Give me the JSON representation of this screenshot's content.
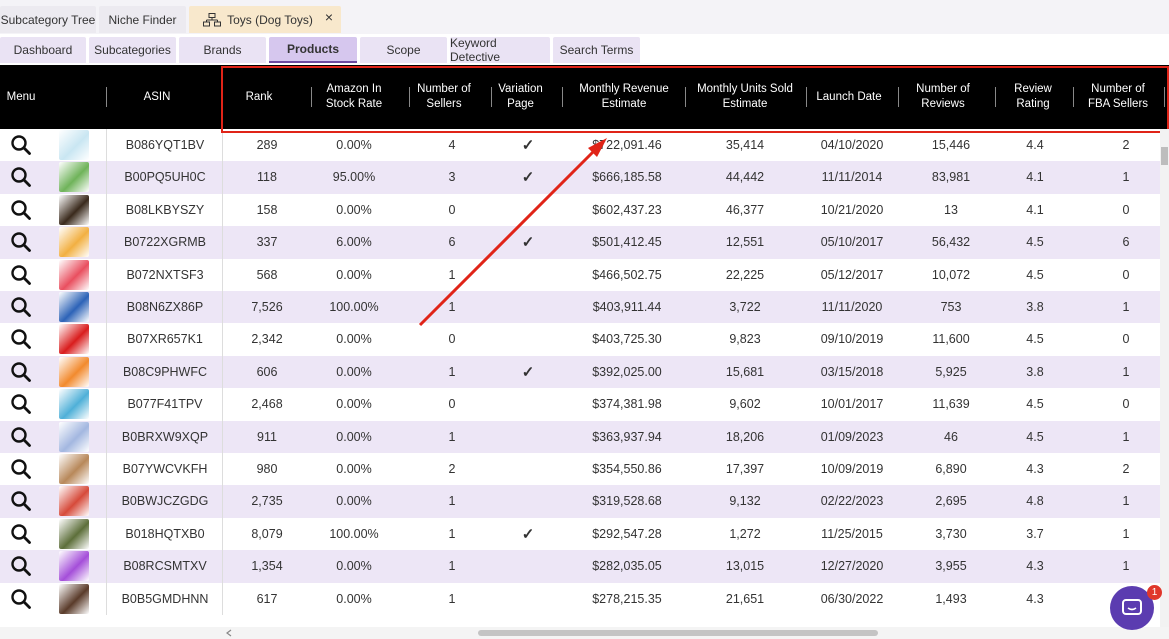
{
  "top_tabs": [
    {
      "label": "Subcategory Tree"
    },
    {
      "label": "Niche Finder"
    },
    {
      "label": "Toys (Dog Toys)"
    }
  ],
  "close_glyph": "×",
  "nav_tabs": [
    {
      "label": "Dashboard"
    },
    {
      "label": "Subcategories"
    },
    {
      "label": "Brands"
    },
    {
      "label": "Products"
    },
    {
      "label": "Scope"
    },
    {
      "label": "Keyword Detective"
    },
    {
      "label": "Search Terms"
    }
  ],
  "columns": [
    "Menu",
    "ASIN",
    "Rank",
    "Amazon In Stock Rate",
    "Number of Sellers",
    "Variation Page",
    "Monthly Revenue Estimate",
    "Monthly Units Sold Estimate",
    "Launch Date",
    "Number of Reviews",
    "Review Rating",
    "Number of FBA Sellers"
  ],
  "colors": {
    "accent": "#6b4aa0",
    "highlight": "#e02418",
    "row_alt": "#ede6f6",
    "header_bg": "#000000"
  },
  "check_glyph": "✓",
  "rows": [
    {
      "asin": "B086YQT1BV",
      "rank": "289",
      "stock": "0.00%",
      "sellers": "4",
      "variation": true,
      "revenue": "$722,091.46",
      "units": "35,414",
      "launch": "04/10/2020",
      "reviews": "15,446",
      "rating": "4.4",
      "fba": "2"
    },
    {
      "asin": "B00PQ5UH0C",
      "rank": "118",
      "stock": "95.00%",
      "sellers": "3",
      "variation": true,
      "revenue": "$666,185.58",
      "units": "44,442",
      "launch": "11/11/2014",
      "reviews": "83,981",
      "rating": "4.1",
      "fba": "1"
    },
    {
      "asin": "B08LKBYSZY",
      "rank": "158",
      "stock": "0.00%",
      "sellers": "0",
      "variation": false,
      "revenue": "$602,437.23",
      "units": "46,377",
      "launch": "10/21/2020",
      "reviews": "13",
      "rating": "4.1",
      "fba": "0"
    },
    {
      "asin": "B0722XGRMB",
      "rank": "337",
      "stock": "6.00%",
      "sellers": "6",
      "variation": true,
      "revenue": "$501,412.45",
      "units": "12,551",
      "launch": "05/10/2017",
      "reviews": "56,432",
      "rating": "4.5",
      "fba": "6"
    },
    {
      "asin": "B072NXTSF3",
      "rank": "568",
      "stock": "0.00%",
      "sellers": "1",
      "variation": false,
      "revenue": "$466,502.75",
      "units": "22,225",
      "launch": "05/12/2017",
      "reviews": "10,072",
      "rating": "4.5",
      "fba": "0"
    },
    {
      "asin": "B08N6ZX86P",
      "rank": "7,526",
      "stock": "100.00%",
      "sellers": "1",
      "variation": false,
      "revenue": "$403,911.44",
      "units": "3,722",
      "launch": "11/11/2020",
      "reviews": "753",
      "rating": "3.8",
      "fba": "1"
    },
    {
      "asin": "B07XR657K1",
      "rank": "2,342",
      "stock": "0.00%",
      "sellers": "0",
      "variation": false,
      "revenue": "$403,725.30",
      "units": "9,823",
      "launch": "09/10/2019",
      "reviews": "11,600",
      "rating": "4.5",
      "fba": "0"
    },
    {
      "asin": "B08C9PHWFC",
      "rank": "606",
      "stock": "0.00%",
      "sellers": "1",
      "variation": true,
      "revenue": "$392,025.00",
      "units": "15,681",
      "launch": "03/15/2018",
      "reviews": "5,925",
      "rating": "3.8",
      "fba": "1"
    },
    {
      "asin": "B077F41TPV",
      "rank": "2,468",
      "stock": "0.00%",
      "sellers": "0",
      "variation": false,
      "revenue": "$374,381.98",
      "units": "9,602",
      "launch": "10/01/2017",
      "reviews": "11,639",
      "rating": "4.5",
      "fba": "0"
    },
    {
      "asin": "B0BRXW9XQP",
      "rank": "911",
      "stock": "0.00%",
      "sellers": "1",
      "variation": false,
      "revenue": "$363,937.94",
      "units": "18,206",
      "launch": "01/09/2023",
      "reviews": "46",
      "rating": "4.5",
      "fba": "1"
    },
    {
      "asin": "B07YWCVKFH",
      "rank": "980",
      "stock": "0.00%",
      "sellers": "2",
      "variation": false,
      "revenue": "$354,550.86",
      "units": "17,397",
      "launch": "10/09/2019",
      "reviews": "6,890",
      "rating": "4.3",
      "fba": "2"
    },
    {
      "asin": "B0BWJCZGDG",
      "rank": "2,735",
      "stock": "0.00%",
      "sellers": "1",
      "variation": false,
      "revenue": "$319,528.68",
      "units": "9,132",
      "launch": "02/22/2023",
      "reviews": "2,695",
      "rating": "4.8",
      "fba": "1"
    },
    {
      "asin": "B018HQTXB0",
      "rank": "8,079",
      "stock": "100.00%",
      "sellers": "1",
      "variation": true,
      "revenue": "$292,547.28",
      "units": "1,272",
      "launch": "11/25/2015",
      "reviews": "3,730",
      "rating": "3.7",
      "fba": "1"
    },
    {
      "asin": "B08RCSMTXV",
      "rank": "1,354",
      "stock": "0.00%",
      "sellers": "1",
      "variation": false,
      "revenue": "$282,035.05",
      "units": "13,015",
      "launch": "12/27/2020",
      "reviews": "3,955",
      "rating": "4.3",
      "fba": "1"
    },
    {
      "asin": "B0B5GMDHNN",
      "rank": "617",
      "stock": "0.00%",
      "sellers": "1",
      "variation": false,
      "revenue": "$278,215.35",
      "units": "21,651",
      "launch": "06/30/2022",
      "reviews": "1,493",
      "rating": "4.3",
      "fba": ""
    }
  ],
  "chat_badge": "1"
}
